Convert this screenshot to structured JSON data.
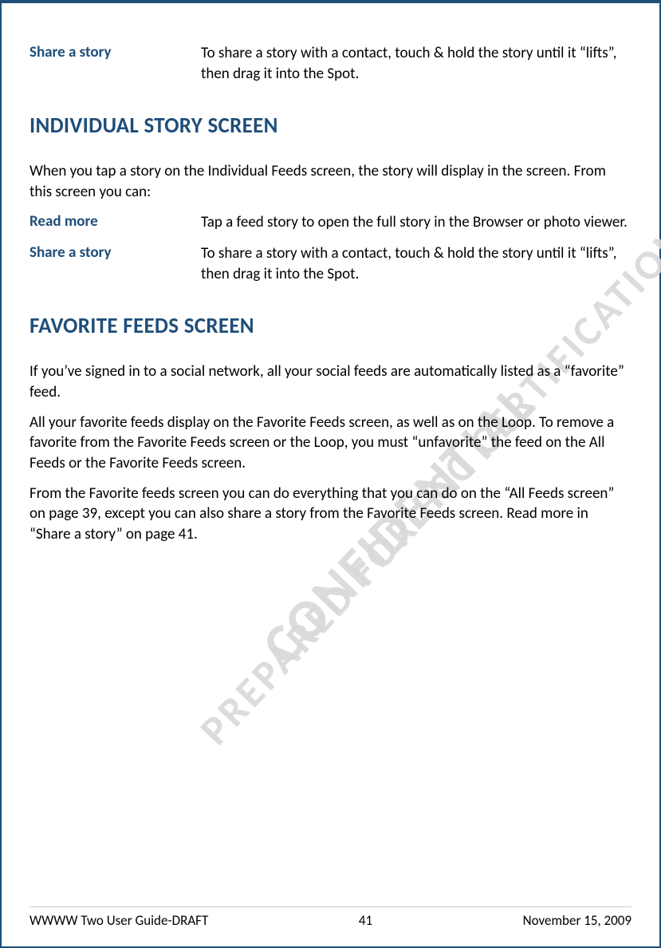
{
  "watermarks": {
    "confidential": "CONFIDENTIAL",
    "prepared": "PREPARED FOR FCC CERTIFICATION"
  },
  "intro_def": {
    "term": "Share a story",
    "desc": "To share a story with a contact, touch & hold the story until it “lifts”, then drag it into the Spot."
  },
  "section1": {
    "heading": "INDIVIDUAL STORY SCREEN",
    "intro": "When you tap a story on the Individual Feeds screen, the story will display in the screen. From this screen you can:",
    "defs": [
      {
        "term": "Read more",
        "desc": "Tap a feed story to open the full story in the Browser or photo viewer."
      },
      {
        "term": "Share a story",
        "desc": "To share a story with a contact, touch & hold the story until it “lifts”, then drag it into the Spot."
      }
    ]
  },
  "section2": {
    "heading": "FAVORITE FEEDS SCREEN",
    "paras": [
      "If you’ve signed in to a social network, all your social feeds are automatically listed as a “favorite” feed.",
      "All your favorite feeds display on the Favorite Feeds screen, as well as on the Loop. To remove a favorite from the Favorite Feeds screen or the Loop, you must “unfavorite” the feed on the All Feeds or the Favorite Feeds screen.",
      "From the Favorite feeds screen you can do everything that you can do on the “All Feeds screen” on page 39, except you can also share a story from the Favorite Feeds screen. Read more in “Share a story” on page 41."
    ]
  },
  "footer": {
    "left": "WWWW Two User Guide-DRAFT",
    "center": "41",
    "right": "November 15, 2009"
  }
}
